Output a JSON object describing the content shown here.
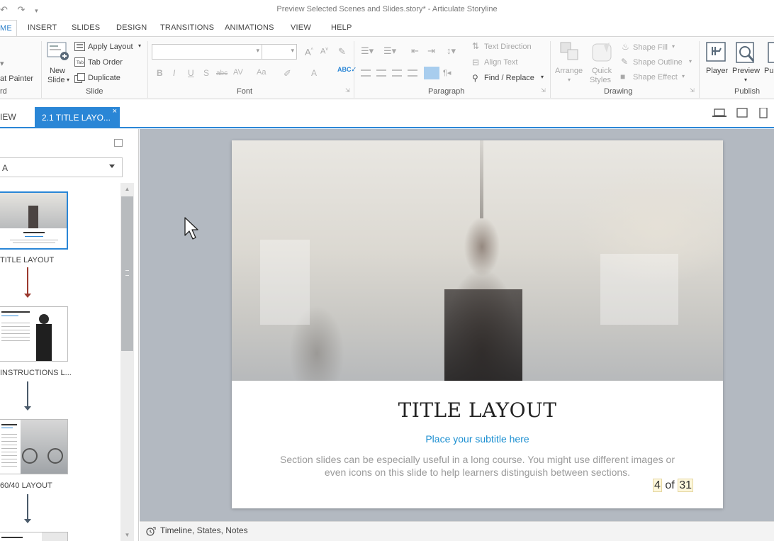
{
  "window": {
    "title": "Preview Selected Scenes and Slides.story* - Articulate Storyline"
  },
  "quick_access": {
    "undo_icon": "undo-icon",
    "redo_icon": "redo-icon",
    "customize_icon": "customize-qat-icon"
  },
  "ribbon_tabs": [
    {
      "label": "ME",
      "active": true
    },
    {
      "label": "INSERT"
    },
    {
      "label": "SLIDES"
    },
    {
      "label": "DESIGN"
    },
    {
      "label": "TRANSITIONS"
    },
    {
      "label": "ANIMATIONS"
    },
    {
      "label": "VIEW"
    },
    {
      "label": "HELP"
    }
  ],
  "ribbon": {
    "clipboard": {
      "format_painter": "at Painter",
      "group_label": "rd"
    },
    "slide": {
      "new_slide_line1": "New",
      "new_slide_line2": "Slide",
      "apply_layout": "Apply Layout",
      "tab_order": "Tab Order",
      "duplicate": "Duplicate",
      "group_label": "Slide"
    },
    "font": {
      "group_label": "Font",
      "buttons": [
        "B",
        "I",
        "U",
        "S",
        "abc",
        "AV",
        "Aa",
        "A"
      ]
    },
    "paragraph": {
      "text_direction": "Text Direction",
      "align_text": "Align Text",
      "find_replace": "Find / Replace",
      "group_label": "Paragraph"
    },
    "drawing": {
      "arrange": "Arrange",
      "quick_styles_1": "Quick",
      "quick_styles_2": "Styles",
      "shape_fill": "Shape Fill",
      "shape_outline": "Shape Outline",
      "shape_effect": "Shape Effect",
      "group_label": "Drawing"
    },
    "publish": {
      "player": "Player",
      "preview": "Preview",
      "publish_partial": "Pu",
      "group_label": "Publish"
    }
  },
  "doc_tabs": {
    "previous": "VIEW",
    "active": "2.1 TITLE LAYO...",
    "close": "×"
  },
  "left_panel": {
    "scene_select": "A",
    "thumbnails": [
      {
        "label": "TITLE LAYOUT",
        "selected": true
      },
      {
        "label": "INSTRUCTIONS L..."
      },
      {
        "label": "60/40 LAYOUT"
      }
    ]
  },
  "slide": {
    "title": "TITLE LAYOUT",
    "subtitle": "Place your subtitle here",
    "body": "Section slides can be especially useful in a long course. You might use different images or even icons on this slide to help learners distinguish between sections.",
    "page_current": "4",
    "page_of": "of",
    "page_total": "31"
  },
  "bottom_bar": {
    "label": "Timeline, States, Notes"
  },
  "colors": {
    "accent": "#2a86d6",
    "subtitle": "#1b8fd1",
    "canvas_bg": "#b3b9c1"
  }
}
